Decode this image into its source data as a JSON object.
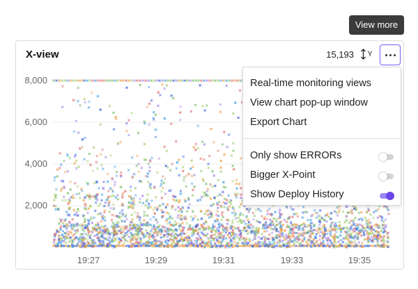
{
  "tooltip": {
    "text": "View more"
  },
  "card": {
    "title": "X-view",
    "count": "15,193",
    "axis_toggle_label": "Y",
    "more_button_icon": "ellipsis-icon"
  },
  "menu": {
    "items": [
      {
        "label": "Real-time monitoring views"
      },
      {
        "label": "View chart pop-up window"
      },
      {
        "label": "Export Chart"
      }
    ],
    "toggles": [
      {
        "label": "Only show ERRORs",
        "on": false
      },
      {
        "label": "Bigger X-Point",
        "on": false
      },
      {
        "label": "Show Deploy History",
        "on": true
      }
    ]
  },
  "colors": {
    "accent": "#6b46e8",
    "points": [
      "#3b63d9",
      "#4aa3e8",
      "#7fc06a",
      "#f0a24a",
      "#a58be8",
      "#e07070",
      "#a8d070"
    ]
  },
  "chart_data": {
    "type": "scatter",
    "y_ticks": [
      "8,000",
      "6,000",
      "4,000",
      "2,000"
    ],
    "x_ticks": [
      "19:27",
      "19:29",
      "19:31",
      "19:33",
      "19:35"
    ],
    "ylim": [
      0,
      8000
    ],
    "xlim": [
      "19:26",
      "19:36"
    ],
    "grid": true
  }
}
